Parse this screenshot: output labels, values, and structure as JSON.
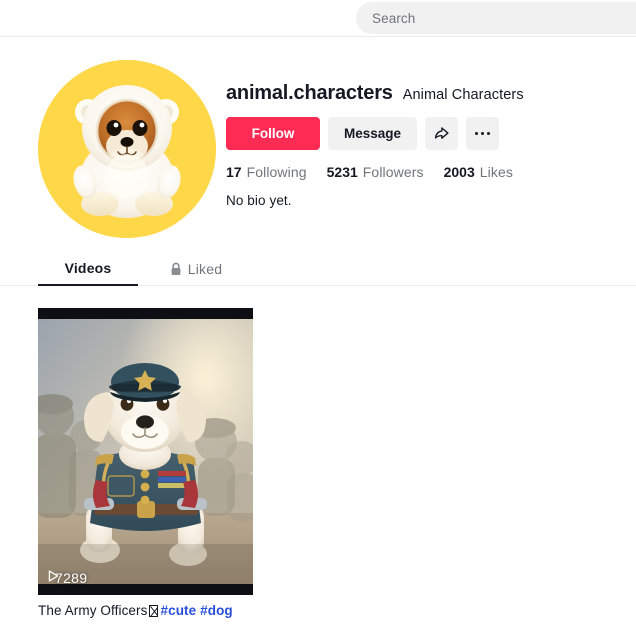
{
  "header": {
    "search": {
      "placeholder": "Search",
      "value": ""
    }
  },
  "profile": {
    "avatar_icon": "plush-dog-in-bear-hoodie-avatar",
    "avatar_background": "#ffd84a",
    "username": "animal.characters",
    "nickname": "Animal Characters",
    "buttons": {
      "follow": "Follow",
      "message": "Message",
      "share_icon": "share-arrow-icon",
      "more_icon": "ellipsis-icon"
    },
    "stats": [
      {
        "count": "17",
        "label": "Following"
      },
      {
        "count": "5231",
        "label": "Followers"
      },
      {
        "count": "2003",
        "label": "Likes"
      }
    ],
    "bio": "No bio yet."
  },
  "tabs": [
    {
      "label": "Videos",
      "icon": "",
      "active": true
    },
    {
      "label": "Liked",
      "icon": "lock-icon",
      "active": false
    }
  ],
  "videos": [
    {
      "thumbnail_icon": "puppy-in-military-uniform-thumbnail",
      "play_icon": "play-triangle-icon",
      "play_count": "7289",
      "caption_text": "The Army Officers",
      "caption_emoji_tofu": "☒",
      "hashtags": [
        "#cute",
        "#dog"
      ]
    }
  ],
  "colors": {
    "accent_red": "#fe2c55",
    "button_gray": "#f1f1f2",
    "text_primary": "#161823",
    "text_secondary": "#73747b",
    "hashtag_blue": "#2a4fdd",
    "avatar_yellow": "#ffd84a"
  }
}
